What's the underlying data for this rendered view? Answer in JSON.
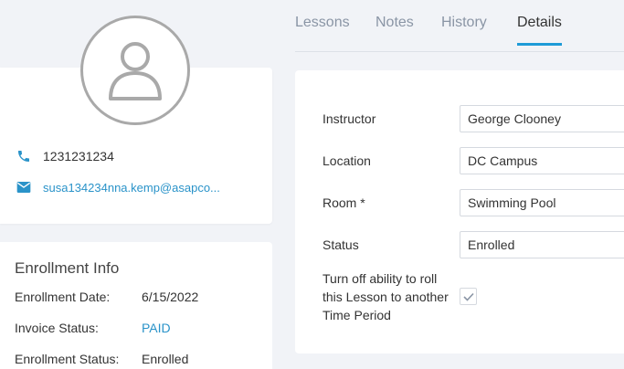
{
  "contact": {
    "phone": "1231231234",
    "email": "susa134234nna.kemp@asapco..."
  },
  "enrollment": {
    "title": "Enrollment Info",
    "rows": [
      {
        "label": "Enrollment Date:",
        "value": "6/15/2022"
      },
      {
        "label": "Invoice Status:",
        "value": "PAID"
      },
      {
        "label": "Enrollment Status:",
        "value": "Enrolled"
      }
    ]
  },
  "tabs": [
    {
      "label": "Lessons"
    },
    {
      "label": "Notes"
    },
    {
      "label": "History"
    },
    {
      "label": "Details",
      "active": true
    }
  ],
  "details": {
    "fields": [
      {
        "label": "Instructor",
        "value": "George Clooney"
      },
      {
        "label": "Location",
        "value": "DC Campus"
      },
      {
        "label": "Room *",
        "value": "Swimming Pool"
      },
      {
        "label": "Status",
        "value": "Enrolled"
      }
    ],
    "checkbox_label": "Turn off ability to roll this Lesson to another Time Period",
    "checkbox_checked": true
  },
  "colors": {
    "accent": "#1e9bd7",
    "link": "#2a93c9",
    "background": "#f1f3f7"
  },
  "icons": [
    "user-avatar-icon",
    "phone-icon",
    "email-icon",
    "checkmark-icon"
  ]
}
